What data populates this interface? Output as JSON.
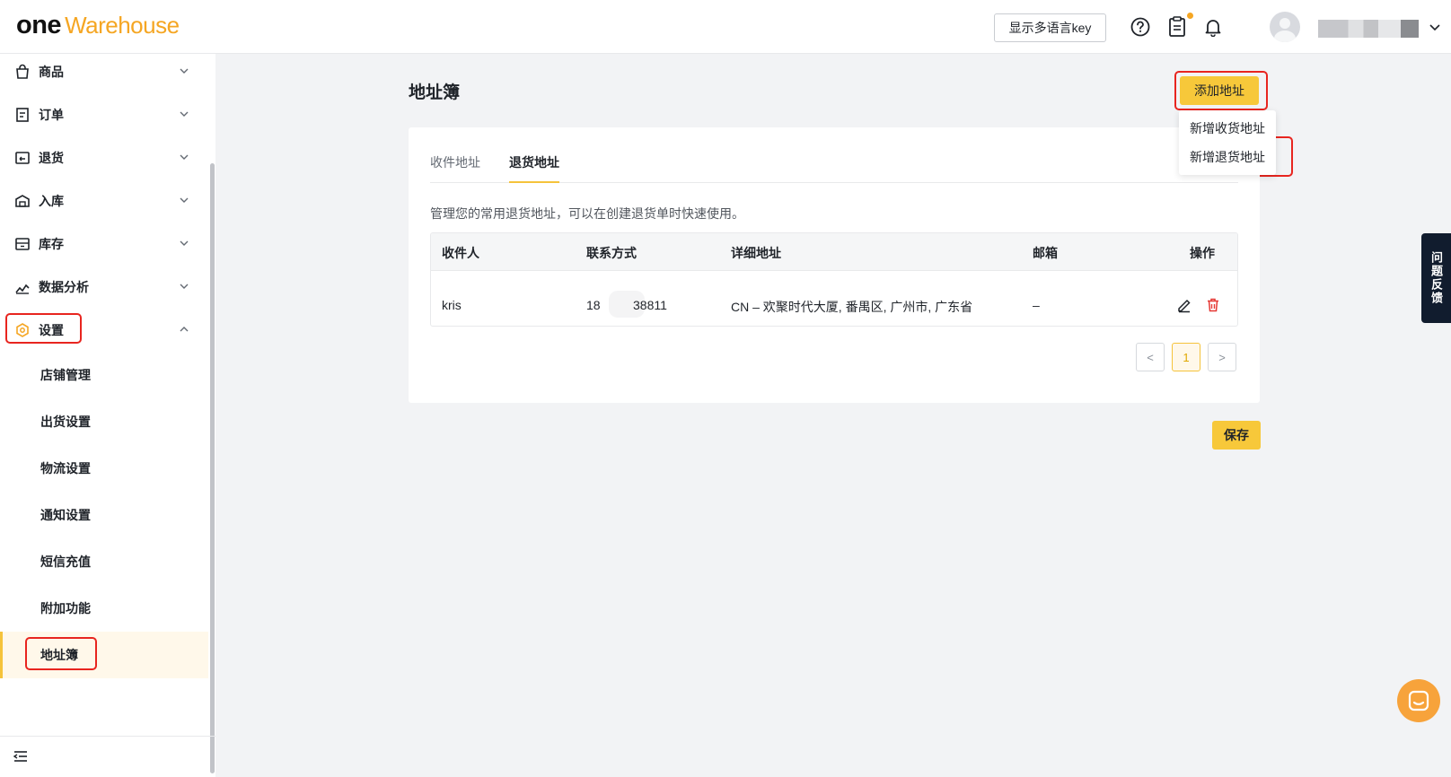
{
  "brand": {
    "part1": "one",
    "part2": "Warehouse",
    "accent": "#f5a623"
  },
  "header": {
    "lang_key_label": "显示多语言key",
    "icons": [
      "help-icon",
      "clipboard-icon",
      "bell-icon",
      "avatar",
      "chevron-down-icon"
    ]
  },
  "sidebar": {
    "menu": [
      {
        "label": "商品",
        "icon": "bag-icon",
        "expanded": false
      },
      {
        "label": "订单",
        "icon": "order-icon",
        "expanded": false
      },
      {
        "label": "退货",
        "icon": "return-icon",
        "expanded": false
      },
      {
        "label": "入库",
        "icon": "inbound-icon",
        "expanded": false
      },
      {
        "label": "库存",
        "icon": "inventory-icon",
        "expanded": false
      },
      {
        "label": "数据分析",
        "icon": "chart-icon",
        "expanded": false
      },
      {
        "label": "设置",
        "icon": "settings-icon",
        "expanded": true
      }
    ],
    "settings_sub": [
      {
        "label": "店铺管理"
      },
      {
        "label": "出货设置"
      },
      {
        "label": "物流设置"
      },
      {
        "label": "通知设置"
      },
      {
        "label": "短信充值"
      },
      {
        "label": "附加功能"
      },
      {
        "label": "地址簿",
        "active": true
      }
    ]
  },
  "main": {
    "title": "地址簿",
    "add_button": "添加地址",
    "dropdown": [
      "新增收货地址",
      "新增退货地址"
    ],
    "tabs": [
      {
        "label": "收件地址",
        "active": false
      },
      {
        "label": "退货地址",
        "active": true
      }
    ],
    "description": "管理您的常用退货地址，可以在创建退货单时快速使用。",
    "table": {
      "columns": [
        "收件人",
        "联系方式",
        "详细地址",
        "邮箱",
        "操作"
      ],
      "rows": [
        {
          "recipient": "kris",
          "phone_prefix": "18",
          "phone_suffix": "38811",
          "address": "CN – 欢聚时代大厦, 番禺区, 广州市, 广东省",
          "email": "–"
        }
      ]
    },
    "pagination": {
      "prev": "<",
      "current": "1",
      "next": ">"
    },
    "save_button": "保存"
  },
  "feedback_label": "问题反馈",
  "colors": {
    "primary_yellow": "#f7c83a",
    "highlight_red": "#e8251f",
    "delete_red": "#e53935"
  }
}
